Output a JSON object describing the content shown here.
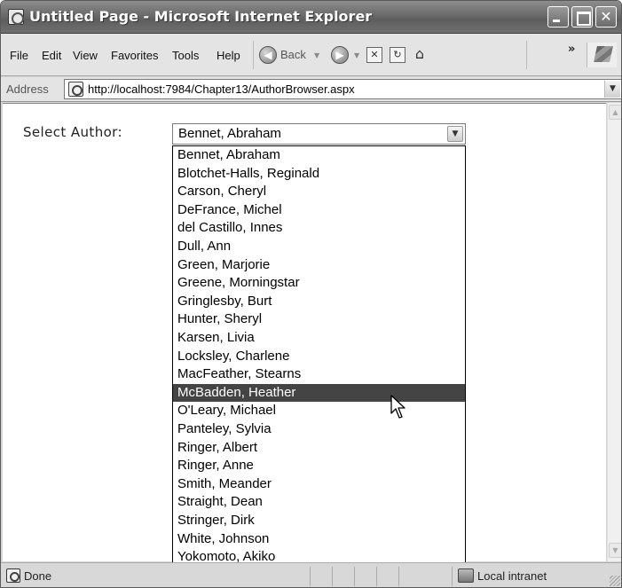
{
  "window": {
    "title": "Untitled Page - Microsoft Internet Explorer"
  },
  "menu": {
    "items": [
      "File",
      "Edit",
      "View",
      "Favorites",
      "Tools",
      "Help"
    ]
  },
  "toolbar": {
    "back_label": "Back",
    "overflow": "»"
  },
  "address": {
    "label": "Address",
    "url": "http://localhost:7984/Chapter13/AuthorBrowser.aspx"
  },
  "page": {
    "select_label": "Select Author:",
    "selected_value": "Bennet, Abraham",
    "highlighted_index": 13,
    "options": [
      "Bennet, Abraham",
      "Blotchet-Halls, Reginald",
      "Carson, Cheryl",
      "DeFrance, Michel",
      "del Castillo, Innes",
      "Dull, Ann",
      "Green, Marjorie",
      "Greene, Morningstar",
      "Gringlesby, Burt",
      "Hunter, Sheryl",
      "Karsen, Livia",
      "Locksley, Charlene",
      "MacFeather, Stearns",
      "McBadden, Heather",
      "O'Leary, Michael",
      "Panteley, Sylvia",
      "Ringer, Albert",
      "Ringer, Anne",
      "Smith, Meander",
      "Straight, Dean",
      "Stringer, Dirk",
      "White, Johnson",
      "Yokomoto, Akiko"
    ]
  },
  "status": {
    "text": "Done",
    "zone": "Local intranet"
  }
}
